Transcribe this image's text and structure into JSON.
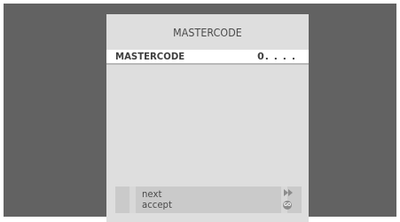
{
  "panel": {
    "title": "MASTERCODE",
    "field": {
      "label": "MASTERCODE",
      "value": "0. . . ."
    }
  },
  "footer": {
    "items": [
      {
        "label": "next",
        "icon": "fast-forward-icon"
      },
      {
        "label": "accept",
        "icon": "go-button-icon",
        "icon_text": "GO"
      }
    ]
  }
}
